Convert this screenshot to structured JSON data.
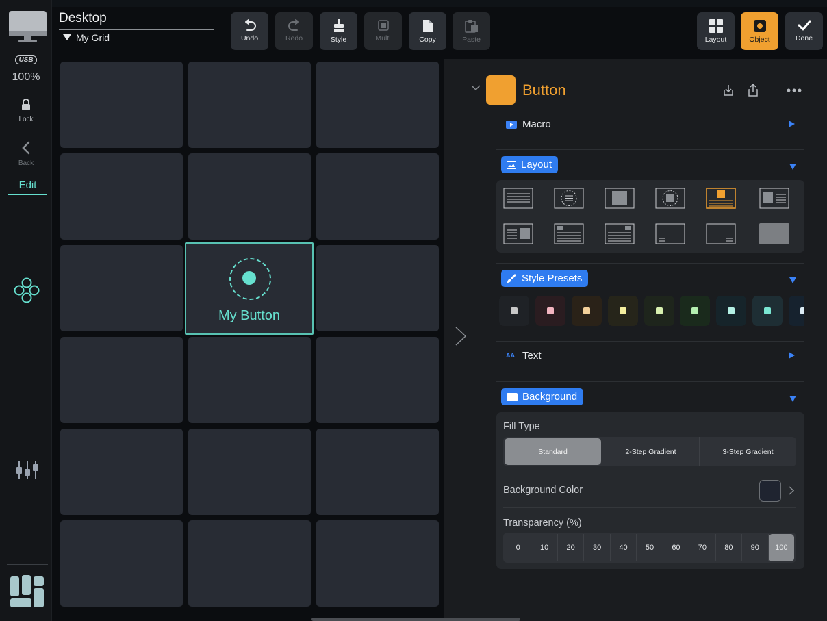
{
  "header": {
    "title": "Desktop",
    "subtitle": "My Grid"
  },
  "rail": {
    "usb_label": "USB",
    "zoom": "100%",
    "lock_label": "Lock",
    "back_label": "Back",
    "edit_label": "Edit"
  },
  "toolbar": {
    "undo": "Undo",
    "redo": "Redo",
    "style": "Style",
    "multi": "Multi",
    "copy": "Copy",
    "paste": "Paste",
    "layout": "Layout",
    "object": "Object",
    "done": "Done"
  },
  "grid": {
    "selected_button_label": "My Button"
  },
  "inspector": {
    "title": "Button",
    "accent_color": "#f0a030",
    "sections": {
      "macro": "Macro",
      "layout": "Layout",
      "style_presets": "Style Presets",
      "text": "Text",
      "background": "Background"
    },
    "presets": [
      {
        "bg": "#1f2226",
        "chip": "#c8c8c8"
      },
      {
        "bg": "#2a1c20",
        "chip": "#f2b4c0"
      },
      {
        "bg": "#2a2218",
        "chip": "#f3d09a"
      },
      {
        "bg": "#26251a",
        "chip": "#f4ee9e"
      },
      {
        "bg": "#1e251c",
        "chip": "#d8f0b0"
      },
      {
        "bg": "#1a2a1c",
        "chip": "#b4eeb0"
      },
      {
        "bg": "#16242a",
        "chip": "#b4f0e4"
      },
      {
        "bg": "#1e2e34",
        "chip": "#7ae6d2"
      },
      {
        "bg": "#16222e",
        "chip": "#dcecf4"
      }
    ],
    "fill_type_label": "Fill Type",
    "fill_types": [
      "Standard",
      "2-Step Gradient",
      "3-Step Gradient"
    ],
    "fill_type_selected": "Standard",
    "background_color_label": "Background Color",
    "background_color": "#1f2430",
    "transparency_label": "Transparency (%)",
    "transparency_options": [
      "0",
      "10",
      "20",
      "30",
      "40",
      "50",
      "60",
      "70",
      "80",
      "90",
      "100"
    ],
    "transparency_selected": "100"
  }
}
